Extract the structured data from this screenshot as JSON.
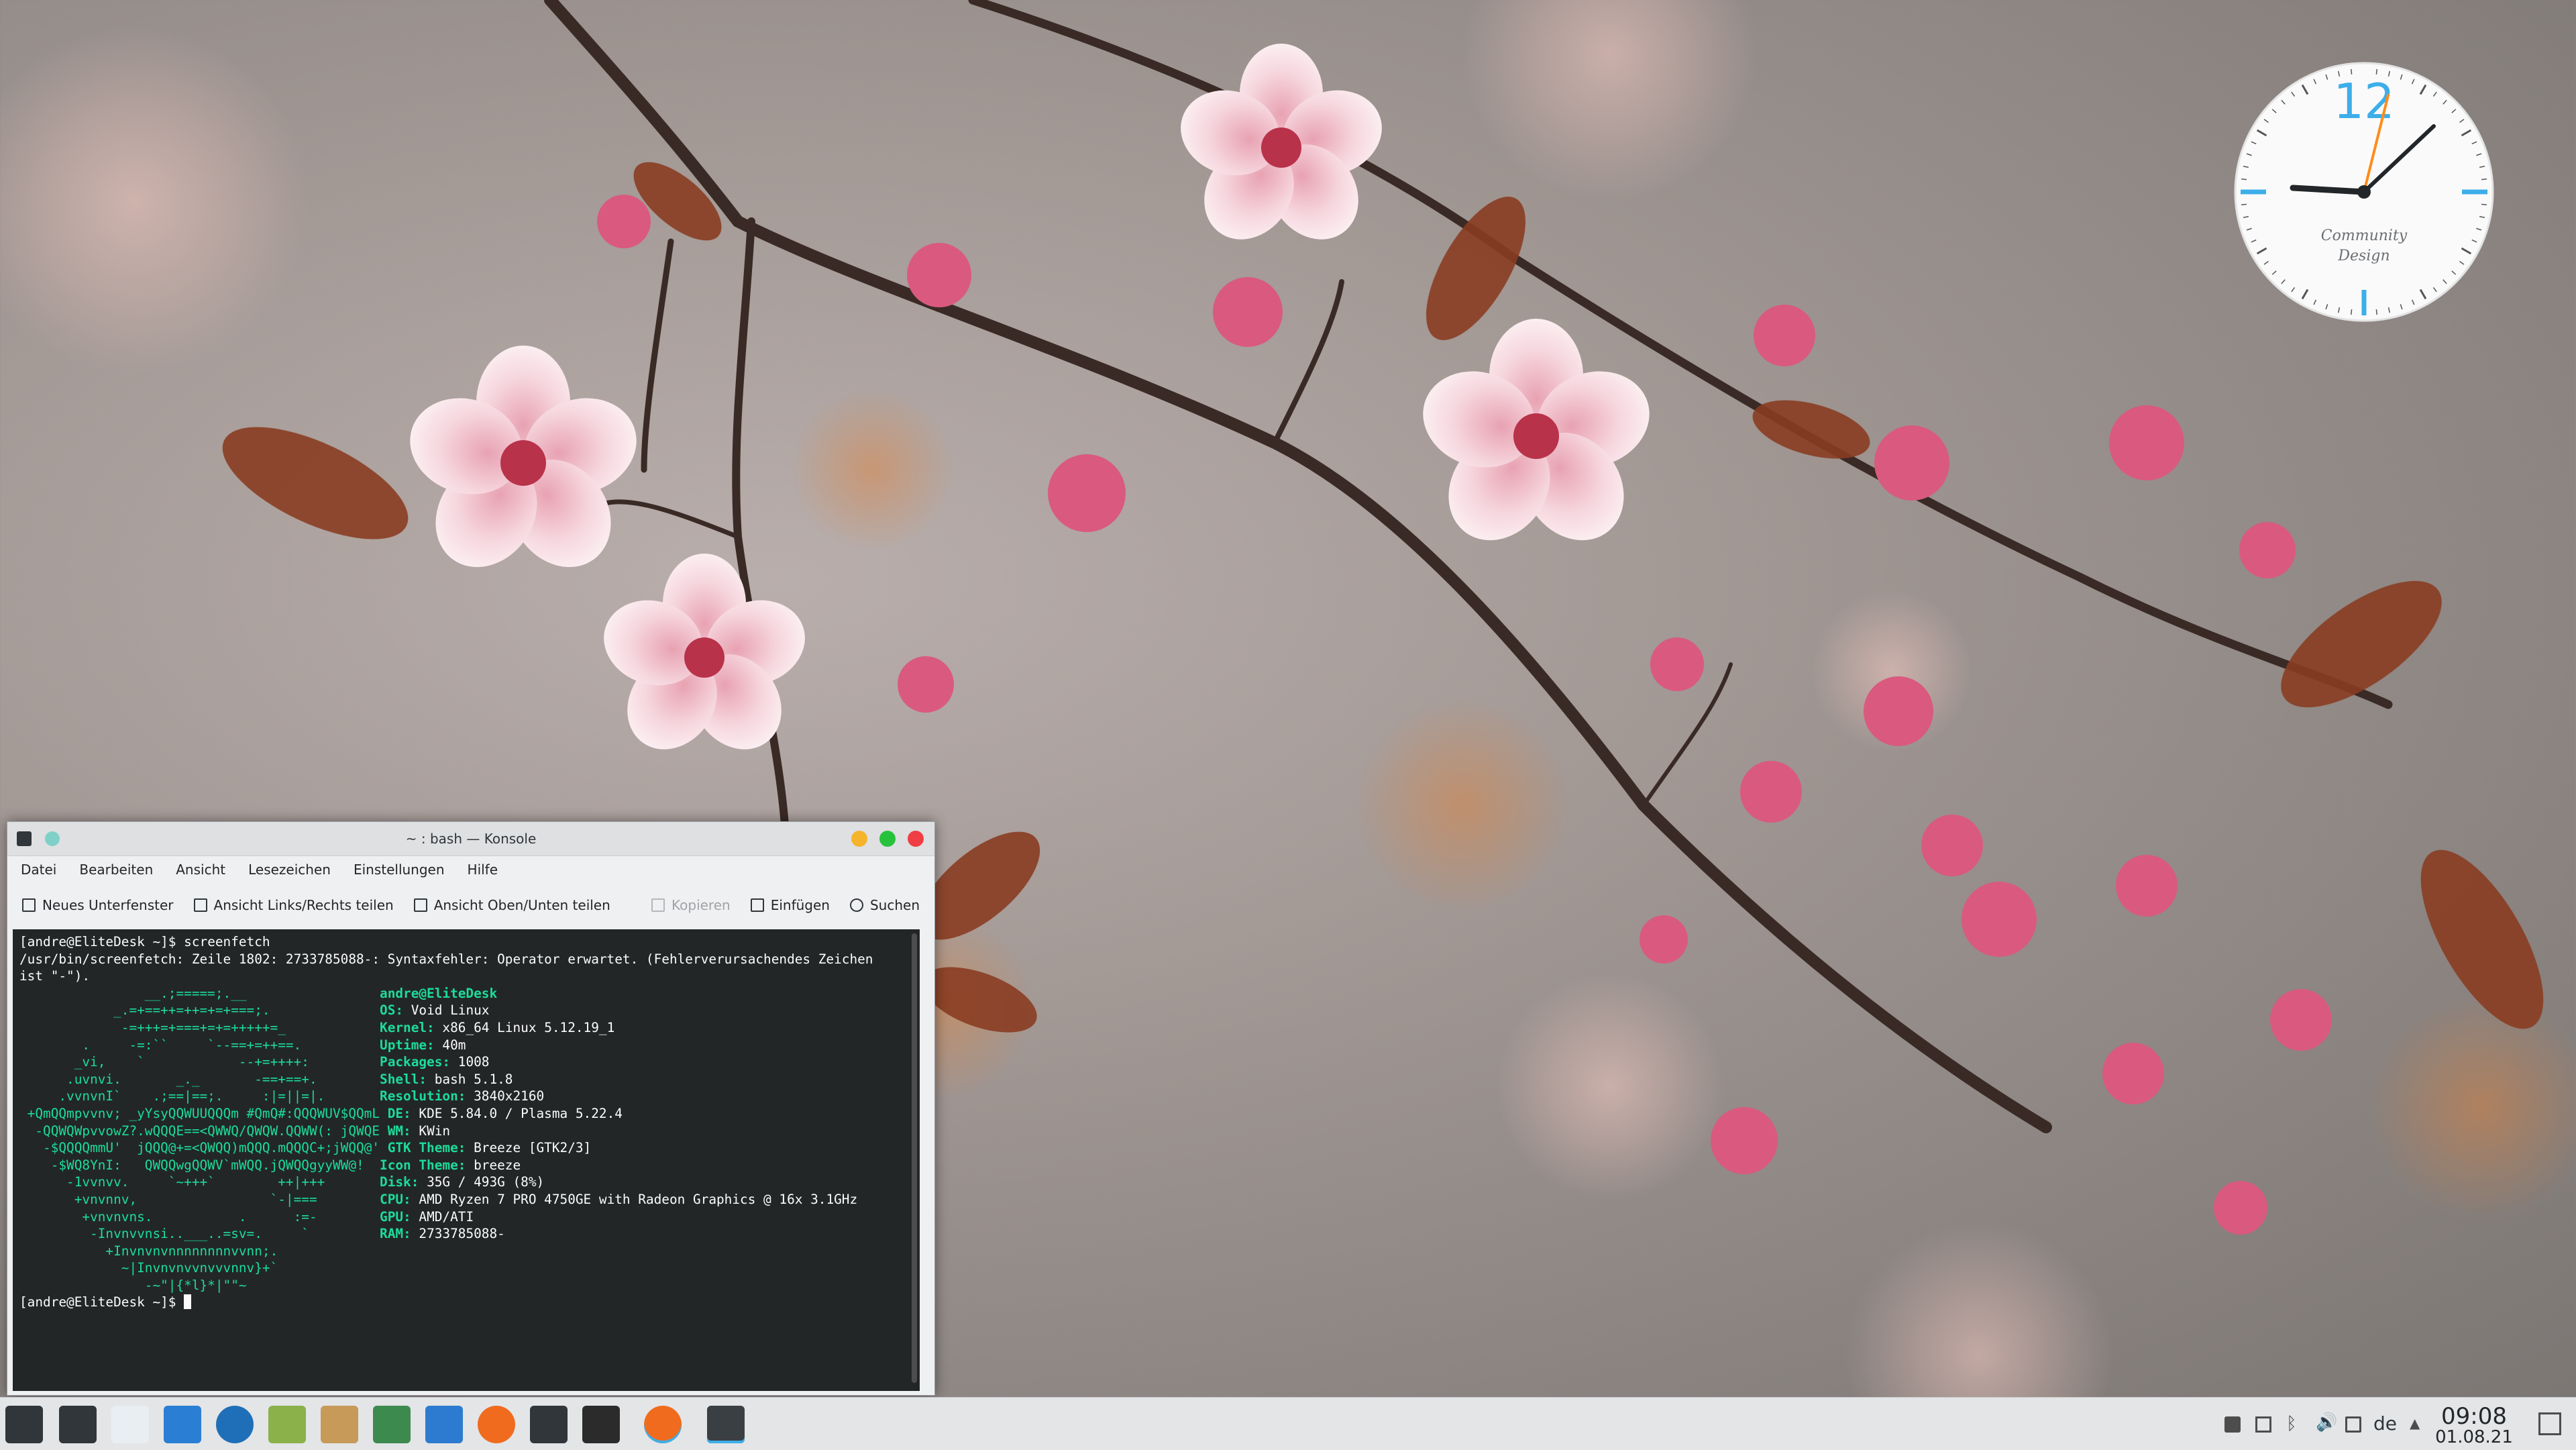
{
  "window": {
    "title": "~ : bash — Konsole",
    "menu": [
      "Datei",
      "Bearbeiten",
      "Ansicht",
      "Lesezeichen",
      "Einstellungen",
      "Hilfe"
    ],
    "toolbar": {
      "new_tab": "Neues Unterfenster",
      "split_lr": "Ansicht Links/Rechts teilen",
      "split_tb": "Ansicht Oben/Unten teilen",
      "copy": "Kopieren",
      "paste": "Einfügen",
      "search": "Suchen"
    }
  },
  "terminal": {
    "prompt": "[andre@EliteDesk ~]$ ",
    "command": "screenfetch",
    "error_line1": "/usr/bin/screenfetch: Zeile 1802: 2733785088-: Syntaxfehler: Operator erwartet. (Fehlerverursachendes Zeichen",
    "error_line2": "ist \"-\").",
    "logo": [
      "                __.;=====;.__",
      "            _.=+==++=++=+=+===;.",
      "             -=+++=+===+=+=+++++=_",
      "        .     -=:``     `--==+=++==.",
      "       _vi,    `            --+=++++:",
      "      .uvnvi.       _._       -==+==+.",
      "     .vvnvnI`    .;==|==;.     :|=||=|.",
      " +QmQQmpvvnv; _yYsyQQWUUQQQm #QmQ#:QQQWUV$QQmL",
      "  -QQWQWpvvowZ?.wQQQE==<QWWQ/QWQW.QQWW(: jQWQE",
      "   -$QQQQmmU'  jQQQ@+=<QWQQ)mQQQ.mQQQC+;jWQQ@'",
      "    -$WQ8YnI:   QWQQwgQQWV`mWQQ.jQWQQgyyWW@!",
      "      -1vvnvv.     `~+++`        ++|+++",
      "       +vnvnnv,                 `-|===",
      "        +vnvnvns.           .      :=-",
      "         -Invnvvnsi..___..=sv=.     `",
      "           +Invnvnvnnnnnnnnvvnn;.",
      "             ~|Invnvnvvnvvvnnv}+`",
      "                -~\"|{*l}*|\"\"~"
    ],
    "info_user": "andre@EliteDesk",
    "info": [
      {
        "k": "OS:",
        "v": " Void Linux"
      },
      {
        "k": "Kernel:",
        "v": " x86_64 Linux 5.12.19_1"
      },
      {
        "k": "Uptime:",
        "v": " 40m"
      },
      {
        "k": "Packages:",
        "v": " 1008"
      },
      {
        "k": "Shell:",
        "v": " bash 5.1.8"
      },
      {
        "k": "Resolution:",
        "v": " 3840x2160"
      },
      {
        "k": "DE:",
        "v": " KDE 5.84.0 / Plasma 5.22.4"
      },
      {
        "k": "WM:",
        "v": " KWin"
      },
      {
        "k": "GTK Theme:",
        "v": " Breeze [GTK2/3]"
      },
      {
        "k": "Icon Theme:",
        "v": " breeze"
      },
      {
        "k": "Disk:",
        "v": " 35G / 493G (8%)"
      },
      {
        "k": "CPU:",
        "v": " AMD Ryzen 7 PRO 4750GE with Radeon Graphics @ 16x 3.1GHz"
      },
      {
        "k": "GPU:",
        "v": " AMD/ATI"
      },
      {
        "k": "RAM:",
        "v": " 2733785088-"
      }
    ]
  },
  "clock_widget": {
    "numeral": "12",
    "label_line1": "Community",
    "label_line2": "Design",
    "accent_color": "#3daee9",
    "hand_color": "#ff8c1a"
  },
  "taskbar": {
    "language": "de",
    "time": "09:08",
    "date": "01.08.21",
    "tasks": [
      "application-launcher-icon",
      "terminal-icon",
      "file-manager-icon",
      "libreoffice-writer-icon",
      "thunderbird-icon",
      "kde-connect-icon",
      "archive-icon",
      "system-monitor-icon",
      "folder-icon",
      "firefox-icon",
      "settings-icon",
      "mediathekview-icon",
      "firefox-window-icon",
      "konsole-window-icon"
    ]
  }
}
